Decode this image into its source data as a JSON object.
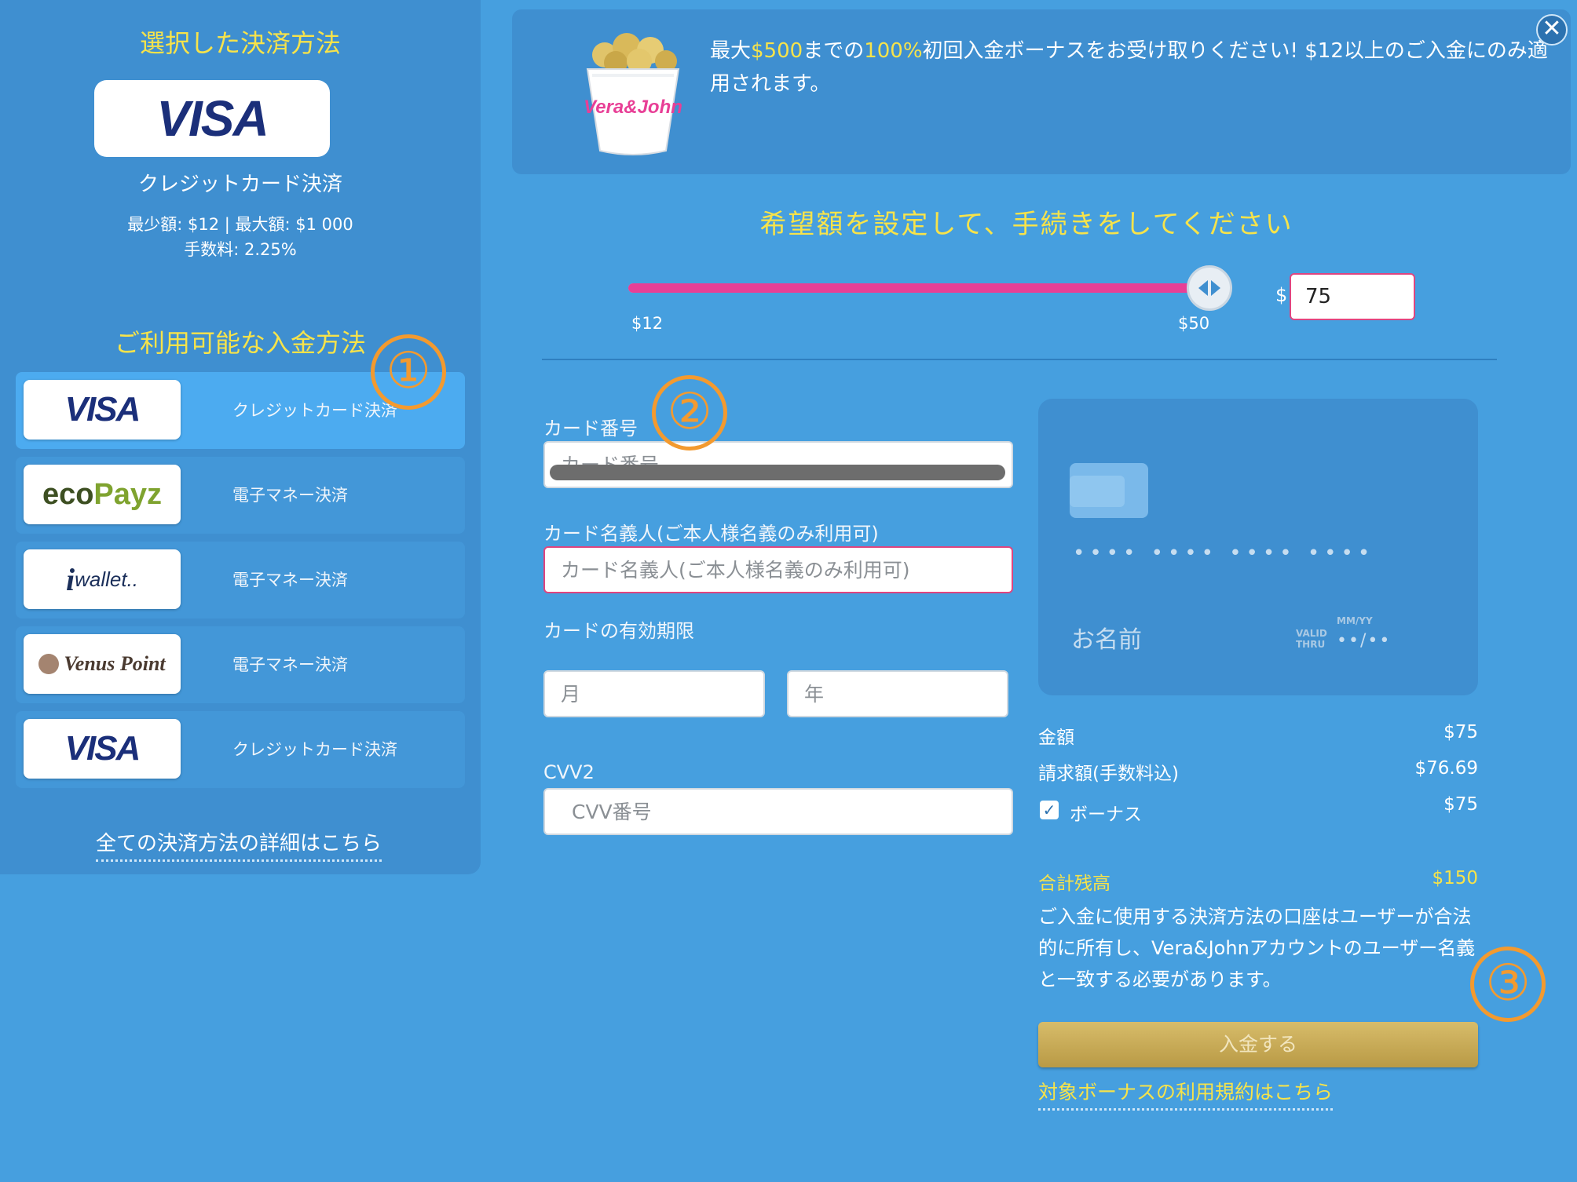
{
  "selected_method": {
    "title": "選択した決済方法",
    "logo": "VISA",
    "name": "クレジットカード決済",
    "limits": "最少額: $12 | 最大額: $1 000",
    "fee": "手数料: 2.25%"
  },
  "available_methods": {
    "title": "ご利用可能な入金方法",
    "items": [
      {
        "logo": "VISA",
        "label": "クレジットカード決済",
        "active": true
      },
      {
        "logo": "ecoPayz",
        "label": "電子マネー決済",
        "active": false
      },
      {
        "logo": "iwallet",
        "label": "電子マネー決済",
        "active": false
      },
      {
        "logo": "Venus Point",
        "label": "電子マネー決済",
        "active": false
      },
      {
        "logo": "VISA",
        "label": "クレジットカード決済",
        "active": false
      }
    ],
    "details_link": "全ての決済方法の詳細はこちら"
  },
  "banner": {
    "pre1": "最大",
    "amount": "$500",
    "pre2": "までの",
    "percent": "100%",
    "rest": "初回入金ボーナスをお受け取りください! $12以上のご入金にのみ適用されます。",
    "image_text": "Vera&John"
  },
  "amount": {
    "heading": "希望額を設定して、手続きをしてください",
    "slider_min_label": "$12",
    "slider_max_label": "$50",
    "slider_fraction": 1.0,
    "currency_symbol": "$",
    "value": "75"
  },
  "form": {
    "card_number_label": "カード番号",
    "card_number_placeholder": "カード番号",
    "holder_label": "カード名義人(ご本人様名義のみ利用可)",
    "holder_placeholder": "カード名義人(ご本人様名義のみ利用可)",
    "expiry_label": "カードの有効期限",
    "month_placeholder": "月",
    "year_placeholder": "年",
    "cvv_label": "CVV2",
    "cvv_placeholder": "CVV番号"
  },
  "card_preview": {
    "number": "•••• •••• •••• ••••",
    "name": "お名前",
    "valid_label_1": "VALID",
    "valid_label_2": "THRU",
    "mmyy_label": "MM/YY",
    "expiry": "••/••"
  },
  "summary": {
    "amount_label": "金額",
    "amount_value": "$75",
    "charge_label": "請求額(手数料込)",
    "charge_value": "$76.69",
    "bonus_label": "ボーナス",
    "bonus_value": "$75",
    "bonus_checked": true,
    "total_label": "合計残高",
    "total_value": "$150",
    "notice": "ご入金に使用する決済方法の口座はユーザーが合法的に所有し、Vera&Johnアカウントのユーザー名義と一致する必要があります。",
    "deposit_button": "入金する",
    "terms_link": "対象ボーナスの利用規約はこちら"
  },
  "annotations": [
    "①",
    "②",
    "③"
  ],
  "close_icon_glyph": "✕",
  "colors": {
    "background": "#469fdf",
    "panel": "#3f8fd0",
    "accent_yellow": "#f7e34a",
    "slider_pink": "#e83f96",
    "annotation_orange": "#f39a2f",
    "button_gold": "#c9ab55"
  }
}
